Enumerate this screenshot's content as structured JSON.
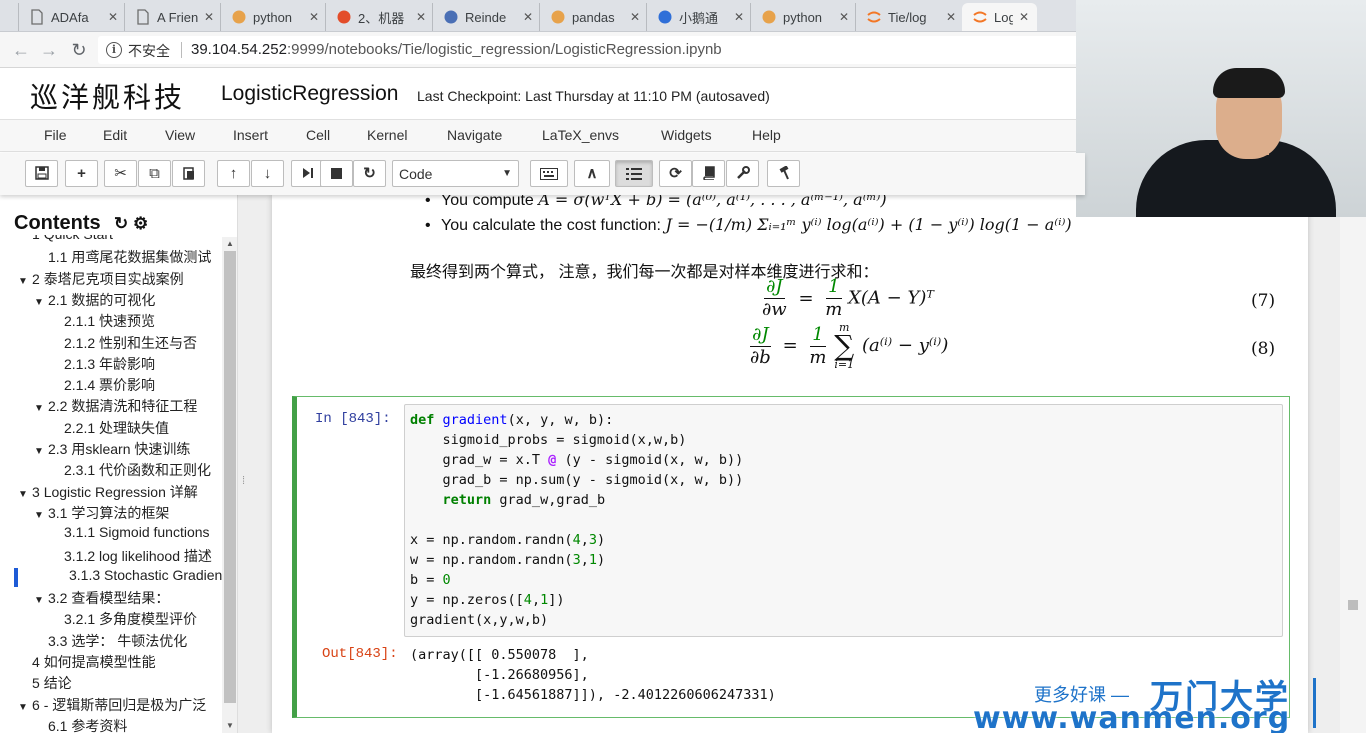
{
  "browser": {
    "tabs": [
      {
        "title": "ADAfa",
        "icon": "document-icon",
        "active": false
      },
      {
        "title": "A Frien",
        "icon": "document-icon",
        "active": false
      },
      {
        "title": "python",
        "icon": "python-icon",
        "active": false
      },
      {
        "title": "2、机器",
        "icon": "csdn-icon",
        "active": false
      },
      {
        "title": "Reinde",
        "icon": "github-icon",
        "active": false
      },
      {
        "title": "pandas",
        "icon": "python-icon",
        "active": false
      },
      {
        "title": "小鹅通",
        "icon": "xiaoe-icon",
        "active": false
      },
      {
        "title": "python",
        "icon": "python-icon",
        "active": false
      },
      {
        "title": "Tie/log",
        "icon": "jupyter-icon",
        "active": false
      },
      {
        "title": "Logistic",
        "icon": "jupyter-icon",
        "active": true
      }
    ],
    "security_label": "不安全",
    "url_host": "39.104.54.252",
    "url_rest": ":9999/notebooks/Tie/logistic_regression/LogisticRegression.ipynb"
  },
  "notebook": {
    "logo": "巡洋舰科技",
    "title": "LogisticRegression",
    "checkpoint": "Last Checkpoint: Last Thursday at 11:10 PM (autosaved)"
  },
  "menu": [
    "File",
    "Edit",
    "View",
    "Insert",
    "Cell",
    "Kernel",
    "Navigate",
    "LaTeX_envs",
    "Widgets",
    "Help"
  ],
  "toolbar": {
    "cell_type": "Code",
    "buttons": [
      "save-icon",
      "plus-icon",
      "scissors-icon",
      "copy-icon",
      "paste-icon",
      "arrow-up-icon",
      "arrow-down-icon",
      "run-icon",
      "stop-icon",
      "restart-icon",
      "keyboard-icon",
      "chevron-up-icon",
      "list-icon",
      "refresh-icon",
      "book-icon",
      "wrench-icon",
      "hammer-icon"
    ]
  },
  "toc": {
    "title": "Contents",
    "items": [
      {
        "level": 1,
        "num": "1",
        "label": "Quick Start",
        "toggle": false,
        "current": false
      },
      {
        "level": 2,
        "num": "1.1",
        "label": "用鸢尾花数据集做测试",
        "toggle": false,
        "current": false
      },
      {
        "level": 1,
        "num": "2",
        "label": "泰塔尼克项目实战案例",
        "toggle": true,
        "current": false
      },
      {
        "level": 2,
        "num": "2.1",
        "label": "数据的可视化",
        "toggle": true,
        "current": false
      },
      {
        "level": 3,
        "num": "2.1.1",
        "label": "快速预览",
        "toggle": false,
        "current": false
      },
      {
        "level": 3,
        "num": "2.1.2",
        "label": "性别和生还与否",
        "toggle": false,
        "current": false
      },
      {
        "level": 3,
        "num": "2.1.3",
        "label": "年龄影响",
        "toggle": false,
        "current": false
      },
      {
        "level": 3,
        "num": "2.1.4",
        "label": "票价影响",
        "toggle": false,
        "current": false
      },
      {
        "level": 2,
        "num": "2.2",
        "label": "数据清洗和特征工程",
        "toggle": true,
        "current": false
      },
      {
        "level": 3,
        "num": "2.2.1",
        "label": "处理缺失值",
        "toggle": false,
        "current": false
      },
      {
        "level": 2,
        "num": "2.3",
        "label": "用sklearn 快速训练",
        "toggle": true,
        "current": false
      },
      {
        "level": 3,
        "num": "2.3.1",
        "label": "代价函数和正则化",
        "toggle": false,
        "current": false
      },
      {
        "level": 1,
        "num": "3",
        "label": "Logistic Regression 详解",
        "toggle": true,
        "current": false
      },
      {
        "level": 2,
        "num": "3.1",
        "label": "学习算法的框架",
        "toggle": true,
        "current": false
      },
      {
        "level": 3,
        "num": "3.1.1",
        "label": "Sigmoid functions",
        "toggle": false,
        "current": false
      },
      {
        "level": 3,
        "num": "3.1.2",
        "label": "log likelihood 描述",
        "toggle": false,
        "current": false
      },
      {
        "level": 3,
        "num": "3.1.3",
        "label": "Stochastic Gradient",
        "toggle": false,
        "current": true
      },
      {
        "level": 2,
        "num": "3.2",
        "label": "查看模型结果：",
        "toggle": true,
        "current": false
      },
      {
        "level": 3,
        "num": "3.2.1",
        "label": "多角度模型评价",
        "toggle": false,
        "current": false
      },
      {
        "level": 2,
        "num": "3.3",
        "label": "选学： 牛顿法优化",
        "toggle": false,
        "current": false
      },
      {
        "level": 1,
        "num": "4",
        "label": "如何提高模型性能",
        "toggle": false,
        "current": false
      },
      {
        "level": 1,
        "num": "5",
        "label": "结论",
        "toggle": false,
        "current": false
      },
      {
        "level": 1,
        "num": "6",
        "label": "- 逻辑斯蒂回归是极为广泛",
        "toggle": true,
        "current": false
      },
      {
        "level": 2,
        "num": "6.1",
        "label": "参考资料",
        "toggle": false,
        "current": false
      }
    ]
  },
  "markdown": {
    "bullet1_prefix": "You compute ",
    "bullet1_math": "A = σ(wᵀX + b) = (a⁽⁰⁾, a⁽¹⁾, . . . , a⁽ᵐ⁻¹⁾, a⁽ᵐ⁾)",
    "bullet2_prefix": "You calculate the cost function: ",
    "bullet2_math": "J = −(1/m) Σᵢ₌₁ᵐ y⁽ⁱ⁾ log(a⁽ⁱ⁾) + (1 − y⁽ⁱ⁾) log(1 − a⁽ⁱ⁾)",
    "paragraph": "最终得到两个算式， 注意，我们每一次都是对样本维度进行求和：",
    "eq7": {
      "lhs_num": "∂J",
      "lhs_den": "∂w",
      "rhs_num": "1",
      "rhs_den": "m",
      "rhs": "X(A − Y)ᵀ",
      "number": "(7)"
    },
    "eq8": {
      "lhs_num": "∂J",
      "lhs_den": "∂b",
      "rhs_num": "1",
      "rhs_den": "m",
      "sum_top": "m",
      "sum_bottom": "i=1",
      "rhs": "(a⁽ⁱ⁾ − y⁽ⁱ⁾)",
      "number": "(8)"
    }
  },
  "cell": {
    "in_prompt": "In  [843]:",
    "out_prompt": "Out[843]:",
    "code_lines": [
      "def gradient(x, y, w, b):",
      "    sigmoid_probs = sigmoid(x,w,b)",
      "    grad_w = x.T @ (y - sigmoid(x, w, b))",
      "    grad_b = np.sum(y - sigmoid(x, w, b))",
      "    return grad_w,grad_b",
      "",
      "x = np.random.randn(4,3)",
      "w = np.random.randn(3,1)",
      "b = 0",
      "y = np.zeros([4,1])",
      "gradient(x,y,w,b)"
    ],
    "output_lines": [
      "(array([[ 0.550078  ],",
      "        [-1.26680956],",
      "        [-1.64561887]]), -2.4012260606247331)"
    ]
  },
  "watermark": {
    "tagline": "更多好课 —",
    "brand": "万门大学",
    "url": "www.wanmen.org"
  },
  "colors": {
    "accent_blue": "#1e73c9",
    "cell_border": "#43a047",
    "toc_highlight": "#ffd000",
    "in_prompt": "#303f9f",
    "out_prompt": "#d84315"
  }
}
